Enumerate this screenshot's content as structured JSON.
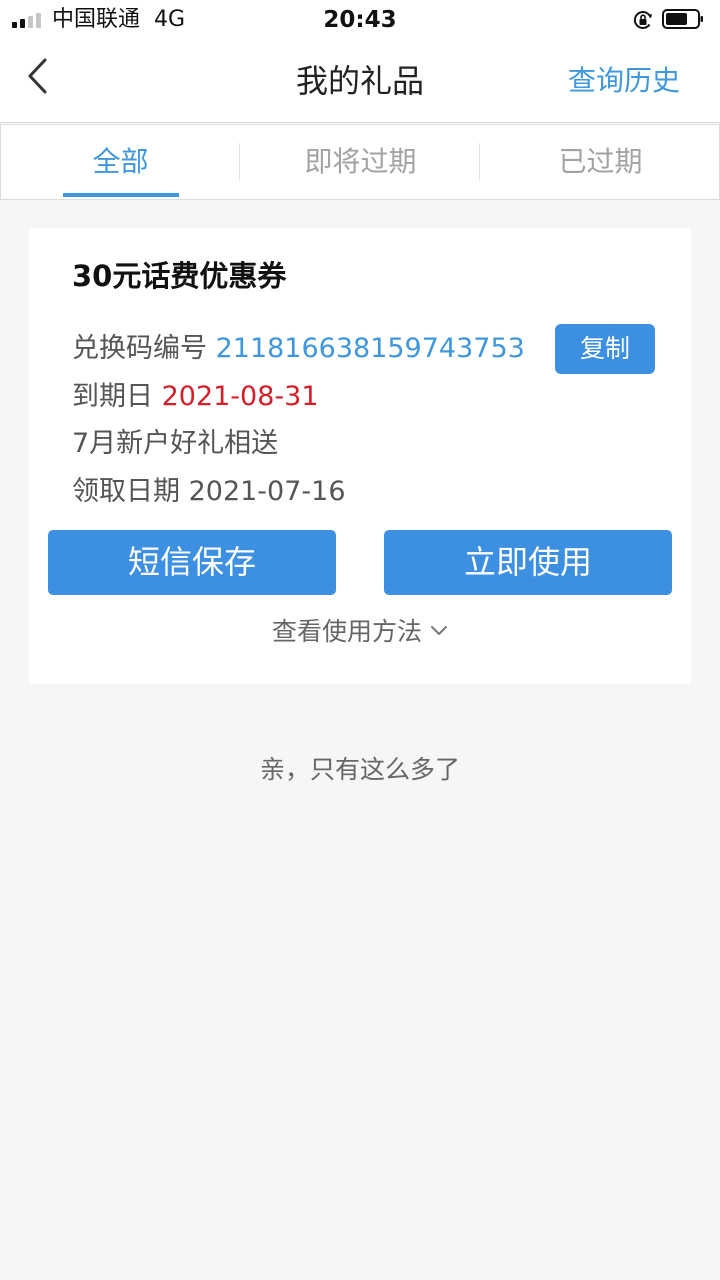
{
  "status_bar": {
    "carrier": "中国联通",
    "network": "4G",
    "time": "20:43",
    "signal_bars_filled": 2,
    "signal_bars_total": 4,
    "icons": [
      "signal-icon",
      "orientation-lock-icon",
      "battery-icon"
    ]
  },
  "nav": {
    "title": "我的礼品",
    "history_link": "查询历史",
    "back_icon": "chevron-left-icon"
  },
  "tabs": [
    {
      "label": "全部",
      "active": true
    },
    {
      "label": "即将过期",
      "active": false
    },
    {
      "label": "已过期",
      "active": false
    }
  ],
  "coupon": {
    "title": "30元话费优惠券",
    "code_label": "兑换码编号",
    "code_value": "211816638159743753",
    "copy_label": "复制",
    "expiry_label": "到期日",
    "expiry_value": "2021-08-31",
    "promo_text": "7月新户好礼相送",
    "received_label": "领取日期",
    "received_value": "2021-07-16",
    "sms_save_label": "短信保存",
    "use_now_label": "立即使用",
    "usage_label": "查看使用方法"
  },
  "end_text": "亲，只有这么多了",
  "colors": {
    "accent": "#3f97dd",
    "button": "#3d8fe2",
    "expiry": "#d71e28",
    "background": "#f6f6f6"
  }
}
